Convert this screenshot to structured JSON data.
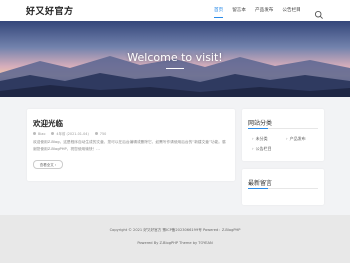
{
  "site": {
    "logo": "好又好官方"
  },
  "nav": {
    "items": [
      {
        "label": "首页",
        "active": true
      },
      {
        "label": "留言本",
        "active": false
      },
      {
        "label": "产品发布",
        "active": false
      },
      {
        "label": "公告栏目",
        "active": false
      }
    ],
    "search_icon": "search-icon"
  },
  "hero": {
    "title": "Welcome to visit!"
  },
  "post": {
    "title": "欢迎光临",
    "author": "Biao",
    "date": "4年前 (2021-01-04)",
    "views": "750",
    "excerpt": "欢迎使用Z-Blog，这是程序自动生成的文章，您可以在后台编辑或删除它，如需写作请使用后台的“新建文章”功能。感谢您使用Z-BlogPHP，祝您使用愉快！...",
    "read_more": "查看全文 ›"
  },
  "sidebar": {
    "categories_title": "网站分类",
    "categories": [
      "未分类",
      "产品发布",
      "公告栏目"
    ],
    "comments_title": "最新留言"
  },
  "footer": {
    "copyright": "Copyright © 2021 好又好官方 豫ICP备2023066199号 Powered：Z-BlogPHP",
    "powered": "Powered By Z-BlogPHP  Theme by TOYEAN"
  },
  "colors": {
    "accent": "#2a8be8",
    "background": "#f2f3f5",
    "footer": "#e8e8e8"
  }
}
